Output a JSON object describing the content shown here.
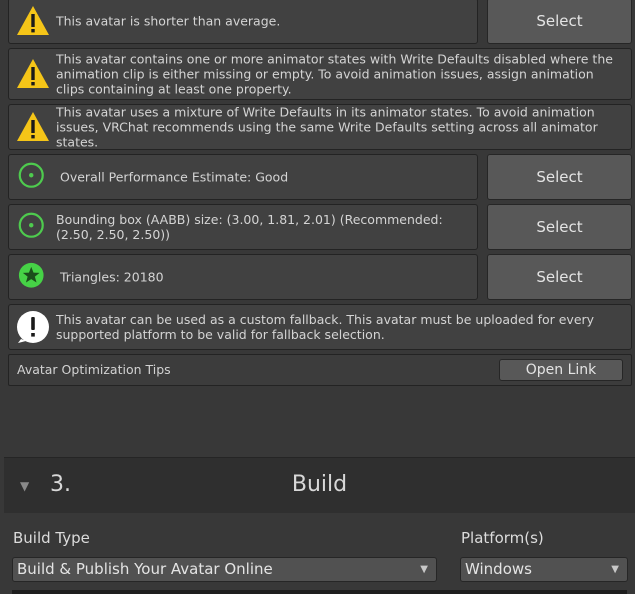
{
  "messages": [
    {
      "icon": "warning-icon",
      "text": "This avatar is shorter than average.",
      "button": "Select"
    },
    {
      "icon": "warning-icon",
      "text": "This avatar contains one or more animator states with Write Defaults disabled where the animation clip is either missing or empty. To avoid animation issues, assign animation clips containing at least one property."
    },
    {
      "icon": "warning-icon",
      "text": "This avatar uses a mixture of Write Defaults in its animator states. To avoid animation issues, VRChat recommends using the same Write Defaults setting across all animator states."
    },
    {
      "icon": "good-performance-icon",
      "text": "Overall Performance Estimate: Good",
      "button": "Select"
    },
    {
      "icon": "good-performance-icon",
      "text": "Bounding box (AABB) size: (3.00, 1.81, 2.01) (Recommended: (2.50, 2.50, 2.50))",
      "button": "Select"
    },
    {
      "icon": "excellent-star-icon",
      "text": "Triangles: 20180",
      "button": "Select"
    },
    {
      "icon": "info-icon",
      "text": "This avatar can be used as a custom fallback. This avatar must be uploaded for every supported platform to be valid for fallback selection."
    }
  ],
  "tips": {
    "label": "Avatar Optimization Tips",
    "link": "Open Link"
  },
  "build": {
    "number": "3.",
    "title": "Build",
    "build_type_label": "Build Type",
    "build_type_value": "Build & Publish Your Avatar Online",
    "platform_label": "Platform(s)",
    "platform_value": "Windows"
  },
  "colors": {
    "warning": "#f5c518",
    "good": "#4ecb4e",
    "star": "#46d246",
    "info": "#ffffff"
  }
}
